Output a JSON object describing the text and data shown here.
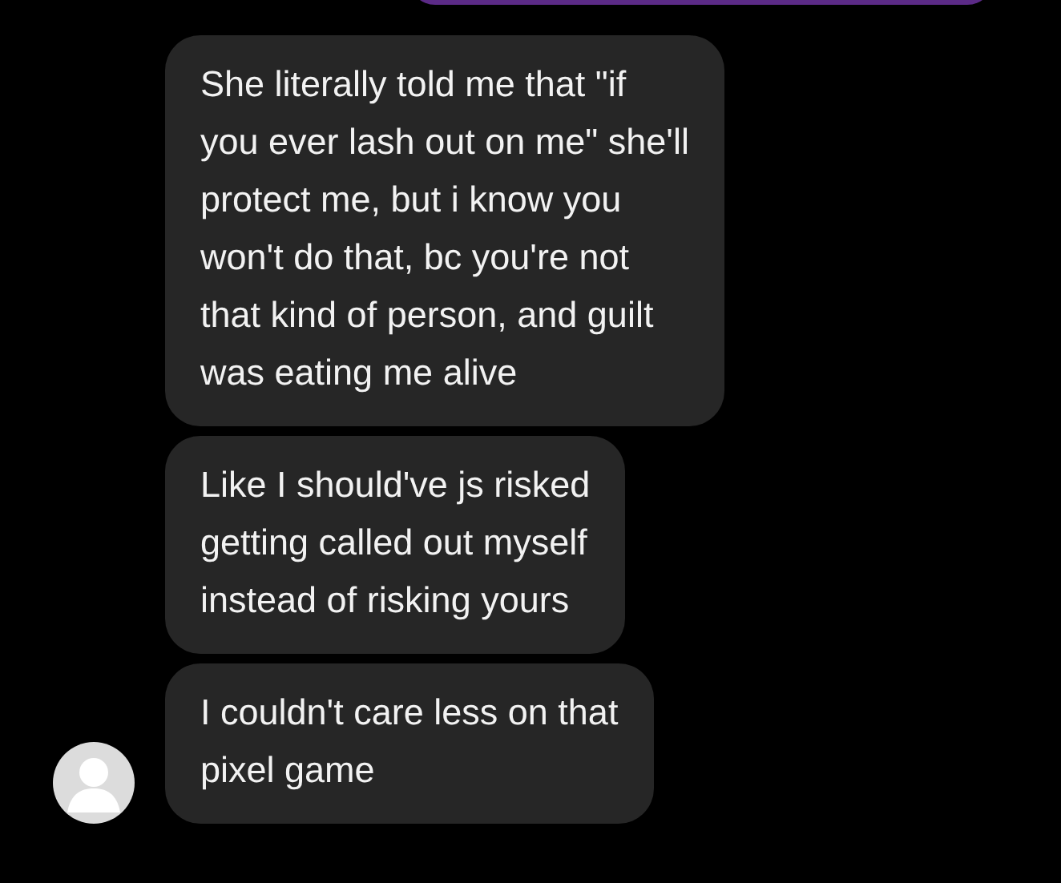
{
  "messages": [
    {
      "text": "She literally told me that \"if\nyou ever lash out on me\" she'll\nprotect me, but i know you\nwon't do that, bc you're not\nthat kind of person, and guilt\nwas eating me alive",
      "avatar": false
    },
    {
      "text": "Like I should've js risked\ngetting called out myself\ninstead of risking yours",
      "avatar": false
    },
    {
      "text": "I couldn't care less on that\npixel game",
      "avatar": true
    }
  ]
}
